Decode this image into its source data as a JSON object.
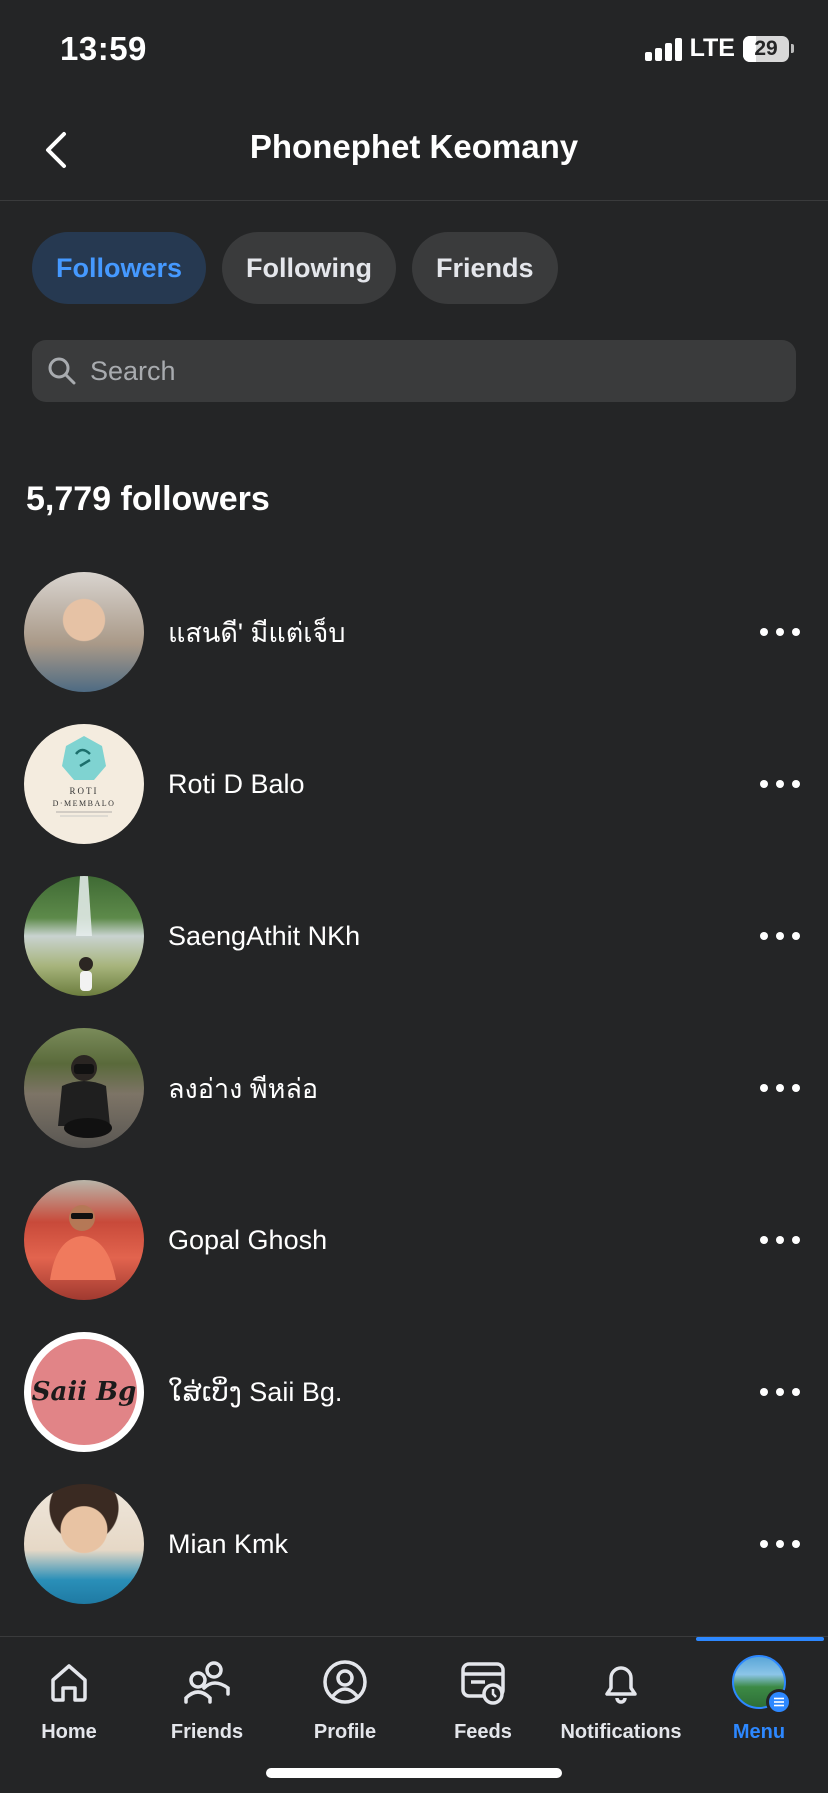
{
  "status_bar": {
    "time": "13:59",
    "network": "LTE",
    "battery": "29",
    "battery_level": 0.29
  },
  "header": {
    "title": "Phonephet Keomany"
  },
  "tabs": [
    {
      "label": "Followers",
      "active": true
    },
    {
      "label": "Following",
      "active": false
    },
    {
      "label": "Friends",
      "active": false
    }
  ],
  "search": {
    "placeholder": "Search"
  },
  "followers_count": "5,779 followers",
  "followers": [
    {
      "name": "แสนดี' มีแต่เจ็บ"
    },
    {
      "name": "Roti D Balo",
      "avatar_text": [
        "ROTI",
        "D·MEMBALO"
      ]
    },
    {
      "name": "SaengAthit NKh"
    },
    {
      "name": "ลงอ่าง พีหล่อ"
    },
    {
      "name": "Gopal Ghosh"
    },
    {
      "name": "ໃສ່ເບິ່ງ Saii Bg.",
      "avatar_text": [
        "Saii Bg"
      ]
    },
    {
      "name": "Mian Kmk"
    }
  ],
  "bottom_nav": [
    {
      "label": "Home",
      "icon": "home-icon"
    },
    {
      "label": "Friends",
      "icon": "friends-icon"
    },
    {
      "label": "Profile",
      "icon": "profile-icon"
    },
    {
      "label": "Feeds",
      "icon": "feeds-icon"
    },
    {
      "label": "Notifications",
      "icon": "bell-icon"
    },
    {
      "label": "Menu",
      "icon": "menu-avatar",
      "active": true
    }
  ],
  "colors": {
    "background": "#242526",
    "accent": "#2d88ff",
    "active_tab_bg": "#263951",
    "chip_bg": "#3a3b3c"
  }
}
